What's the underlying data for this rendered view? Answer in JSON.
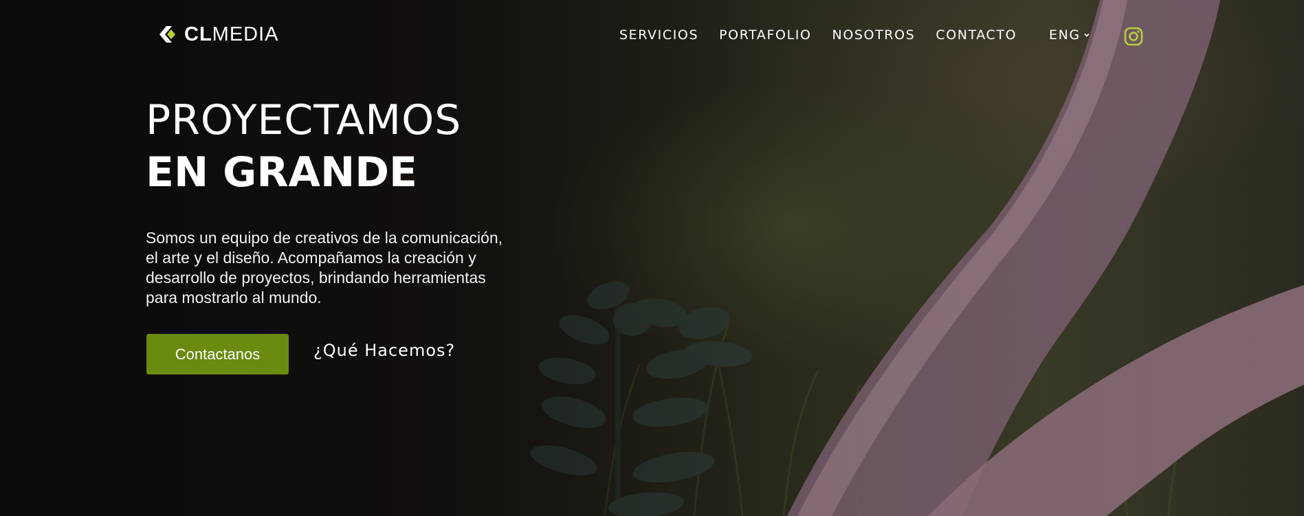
{
  "brand": {
    "logo_bold": "CL",
    "logo_light": "MEDIA",
    "accent_color": "#6a8a10",
    "icon_color": "#b9cf3a"
  },
  "nav": {
    "items": [
      "SERVICIOS",
      "PORTAFOLIO",
      "NOSOTROS",
      "CONTACTO"
    ],
    "language": "ENG",
    "language_icon": "chevron-down-icon",
    "social_icon": "instagram-icon"
  },
  "hero": {
    "headline_line1": "PROYECTAMOS",
    "headline_line2": "EN GRANDE",
    "description": "Somos un equipo de creativos de la comunicación, el arte y el diseño. Acompañamos la creación y desarrollo de proyectos, brindando herramientas para mostrarlo al mundo.",
    "primary_button": "Contactanos",
    "secondary_link": "¿Qué Hacemos?"
  }
}
